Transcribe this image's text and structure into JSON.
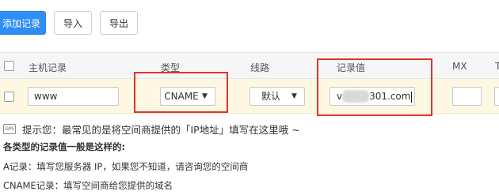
{
  "toolbar": {
    "add_label": "添加记录",
    "import_label": "导入",
    "export_label": "导出"
  },
  "table": {
    "headers": {
      "host": "主机记录",
      "type": "类型",
      "line": "线路",
      "value": "记录值",
      "mx": "MX",
      "ttl": "T"
    },
    "row": {
      "host_value": "www",
      "type_value": "CNAME",
      "line_value": "默认",
      "value_prefix": "v",
      "value_suffix": "301.com",
      "mx_value": "",
      "ttl_value": ""
    }
  },
  "tips": {
    "icon_text": "GPS",
    "hint": "提示您：最常见的是将空间商提供的「IP地址」填写在这里哦 ~",
    "heading": "各类型的记录值一般是这样的:",
    "a_record": "A记录：填写您服务器 IP，如果您不知道，请咨询您的空间商",
    "cname_record": "CNAME记录：填写空间商给您提供的域名"
  },
  "colors": {
    "primary": "#2f8ef5",
    "highlight": "#e0332d",
    "row_background": "#fef8e2"
  }
}
